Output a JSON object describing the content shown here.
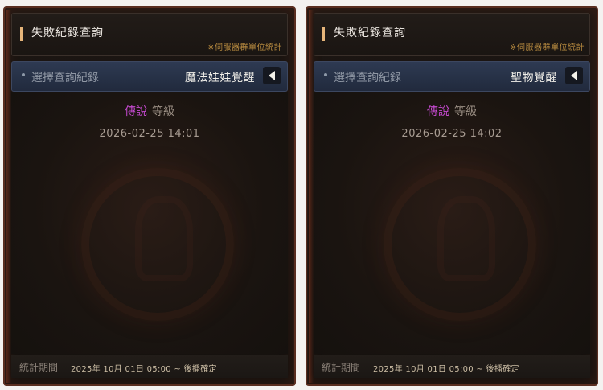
{
  "panels": [
    {
      "title": "失敗紀錄查詢",
      "title_note": "※伺服器群單位統計",
      "selector_label": "選擇查詢紀錄",
      "selector_value": "魔法娃娃覺醒",
      "grade_tier": "傳說",
      "grade_word": "等級",
      "timestamp": "2026-02-25 14:01",
      "footer_label": "統計期間",
      "footer_period": "2025年 10月 01日 05:00 ~ 後播確定"
    },
    {
      "title": "失敗紀錄查詢",
      "title_note": "※伺服器群單位統計",
      "selector_label": "選擇查詢紀錄",
      "selector_value": "聖物覺醒",
      "grade_tier": "傳說",
      "grade_word": "等級",
      "timestamp": "2026-02-25 14:02",
      "footer_label": "統計期間",
      "footer_period": "2025年 10月 01日 05:00 ~ 後播確定"
    }
  ],
  "colors": {
    "legend_tier": "#c64ad1",
    "accent_orange": "#b6893f",
    "selector_bg": "#2e3a52"
  }
}
